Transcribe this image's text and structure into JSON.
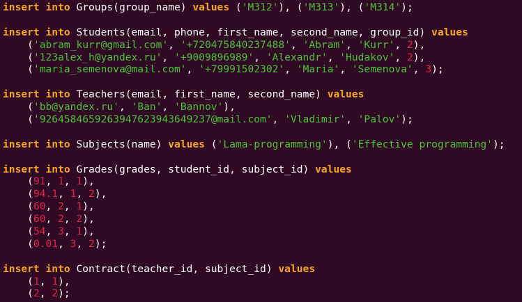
{
  "terminal": {
    "background": "#300a24",
    "colors": {
      "keyword": "#f5a623",
      "string": "#4ec236",
      "number": "#e0244a",
      "plain": "#ffffff"
    },
    "lines": [
      [
        [
          "kw",
          "insert into"
        ],
        [
          "txt",
          " Groups(group_name) "
        ],
        [
          "kw",
          "values"
        ],
        [
          "txt",
          " ("
        ],
        [
          "str",
          "'M312'"
        ],
        [
          "txt",
          "), ("
        ],
        [
          "str",
          "'M313'"
        ],
        [
          "txt",
          "), ("
        ],
        [
          "str",
          "'M314'"
        ],
        [
          "txt",
          ");"
        ]
      ],
      [],
      [
        [
          "kw",
          "insert into"
        ],
        [
          "txt",
          " Students(email, phone, first_name, second_name, group_id) "
        ],
        [
          "kw",
          "values"
        ]
      ],
      [
        [
          "txt",
          "    ("
        ],
        [
          "str",
          "'abram_kurr@gmail.com'"
        ],
        [
          "txt",
          ", "
        ],
        [
          "str",
          "'+720475840237488'"
        ],
        [
          "txt",
          ", "
        ],
        [
          "str",
          "'Abram'"
        ],
        [
          "txt",
          ", "
        ],
        [
          "str",
          "'Kurr'"
        ],
        [
          "txt",
          ", "
        ],
        [
          "num",
          "2"
        ],
        [
          "txt",
          "),"
        ]
      ],
      [
        [
          "txt",
          "    ("
        ],
        [
          "str",
          "'123alex_h@yandex.ru'"
        ],
        [
          "txt",
          ", "
        ],
        [
          "str",
          "'+9009896989'"
        ],
        [
          "txt",
          ", "
        ],
        [
          "str",
          "'Alexandr'"
        ],
        [
          "txt",
          ", "
        ],
        [
          "str",
          "'Hudakov'"
        ],
        [
          "txt",
          ", "
        ],
        [
          "num",
          "2"
        ],
        [
          "txt",
          "),"
        ]
      ],
      [
        [
          "txt",
          "    ("
        ],
        [
          "str",
          "'maria_semenova@mail.com'"
        ],
        [
          "txt",
          ", "
        ],
        [
          "str",
          "'+79991502302'"
        ],
        [
          "txt",
          ", "
        ],
        [
          "str",
          "'Maria'"
        ],
        [
          "txt",
          ", "
        ],
        [
          "str",
          "'Semenova'"
        ],
        [
          "txt",
          ", "
        ],
        [
          "num",
          "3"
        ],
        [
          "txt",
          ");"
        ]
      ],
      [],
      [
        [
          "kw",
          "insert into"
        ],
        [
          "txt",
          " Teachers(email, first_name, second_name) "
        ],
        [
          "kw",
          "values"
        ]
      ],
      [
        [
          "txt",
          "    ("
        ],
        [
          "str",
          "'bb@yandex.ru'"
        ],
        [
          "txt",
          ", "
        ],
        [
          "str",
          "'Ban'"
        ],
        [
          "txt",
          ", "
        ],
        [
          "str",
          "'Bannov'"
        ],
        [
          "txt",
          "),"
        ]
      ],
      [
        [
          "txt",
          "    ("
        ],
        [
          "str",
          "'9264584659263947623943649237@mail.com'"
        ],
        [
          "txt",
          ", "
        ],
        [
          "str",
          "'Vladimir'"
        ],
        [
          "txt",
          ", "
        ],
        [
          "str",
          "'Palov'"
        ],
        [
          "txt",
          ");"
        ]
      ],
      [],
      [
        [
          "kw",
          "insert into"
        ],
        [
          "txt",
          " Subjects(name) "
        ],
        [
          "kw",
          "values"
        ],
        [
          "txt",
          " ("
        ],
        [
          "str",
          "'Lama-programming'"
        ],
        [
          "txt",
          "), ("
        ],
        [
          "str",
          "'Effective programming'"
        ],
        [
          "txt",
          ");"
        ]
      ],
      [],
      [
        [
          "kw",
          "insert into"
        ],
        [
          "txt",
          " Grades(grades, student_id, subject_id) "
        ],
        [
          "kw",
          "values"
        ]
      ],
      [
        [
          "txt",
          "    ("
        ],
        [
          "num",
          "91"
        ],
        [
          "txt",
          ", "
        ],
        [
          "num",
          "1"
        ],
        [
          "txt",
          ", "
        ],
        [
          "num",
          "1"
        ],
        [
          "txt",
          "),"
        ]
      ],
      [
        [
          "txt",
          "    ("
        ],
        [
          "num",
          "94.1"
        ],
        [
          "txt",
          ", "
        ],
        [
          "num",
          "1"
        ],
        [
          "txt",
          ", "
        ],
        [
          "num",
          "2"
        ],
        [
          "txt",
          "),"
        ]
      ],
      [
        [
          "txt",
          "    ("
        ],
        [
          "num",
          "60"
        ],
        [
          "txt",
          ", "
        ],
        [
          "num",
          "2"
        ],
        [
          "txt",
          ", "
        ],
        [
          "num",
          "1"
        ],
        [
          "txt",
          "),"
        ]
      ],
      [
        [
          "txt",
          "    ("
        ],
        [
          "num",
          "60"
        ],
        [
          "txt",
          ", "
        ],
        [
          "num",
          "2"
        ],
        [
          "txt",
          ", "
        ],
        [
          "num",
          "2"
        ],
        [
          "txt",
          "),"
        ]
      ],
      [
        [
          "txt",
          "    ("
        ],
        [
          "num",
          "54"
        ],
        [
          "txt",
          ", "
        ],
        [
          "num",
          "3"
        ],
        [
          "txt",
          ", "
        ],
        [
          "num",
          "1"
        ],
        [
          "txt",
          "),"
        ]
      ],
      [
        [
          "txt",
          "    ("
        ],
        [
          "num",
          "0.01"
        ],
        [
          "txt",
          ", "
        ],
        [
          "num",
          "3"
        ],
        [
          "txt",
          ", "
        ],
        [
          "num",
          "2"
        ],
        [
          "txt",
          ");"
        ]
      ],
      [],
      [
        [
          "kw",
          "insert into"
        ],
        [
          "txt",
          " Contract(teacher_id, subject_id) "
        ],
        [
          "kw",
          "values"
        ]
      ],
      [
        [
          "txt",
          "    ("
        ],
        [
          "num",
          "1"
        ],
        [
          "txt",
          ", "
        ],
        [
          "num",
          "1"
        ],
        [
          "txt",
          "),"
        ]
      ],
      [
        [
          "txt",
          "    ("
        ],
        [
          "num",
          "2"
        ],
        [
          "txt",
          ", "
        ],
        [
          "num",
          "2"
        ],
        [
          "txt",
          ");"
        ]
      ]
    ]
  }
}
